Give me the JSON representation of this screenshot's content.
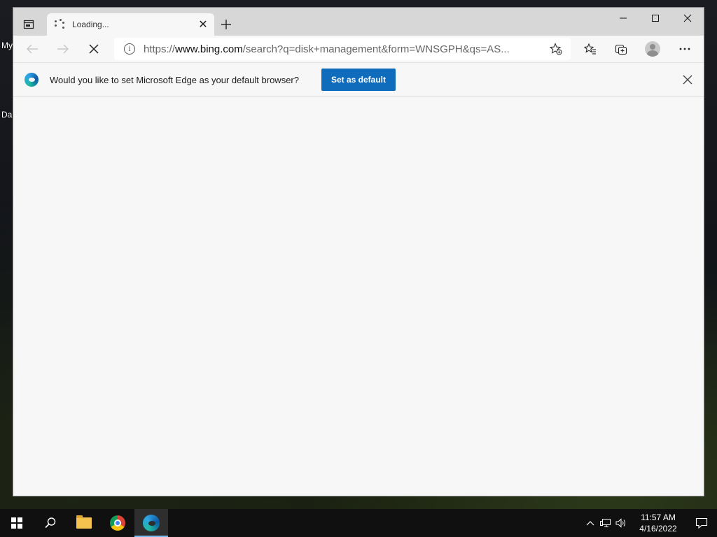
{
  "desktop": {
    "icons": [
      {
        "label": "My"
      },
      {
        "label": "Da"
      }
    ]
  },
  "browser": {
    "tab": {
      "title": "Loading..."
    },
    "window_controls": {
      "minimize": "—",
      "maximize": "☐",
      "close": "✕"
    },
    "toolbar": {
      "url_scheme": "https://",
      "url_host": "www.bing.com",
      "url_rest": "/search?q=disk+management&form=WNSGPH&qs=AS..."
    },
    "infobar": {
      "message": "Would you like to set Microsoft Edge as your default browser?",
      "button_label": "Set as default"
    }
  },
  "taskbar": {
    "apps": [
      {
        "name": "File Explorer"
      },
      {
        "name": "Google Chrome"
      },
      {
        "name": "Microsoft Edge",
        "active": true
      }
    ],
    "clock": {
      "time": "11:57 AM",
      "date": "4/16/2022"
    }
  },
  "colors": {
    "accent": "#0f6cbd",
    "taskbar_active_indicator": "#76b9ed"
  }
}
